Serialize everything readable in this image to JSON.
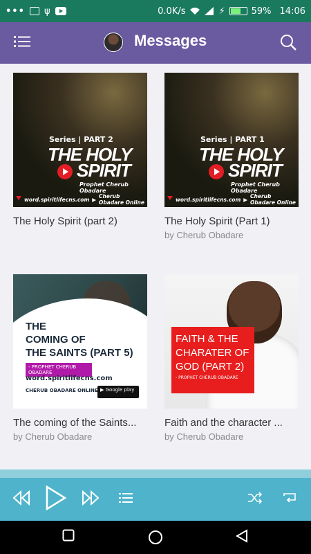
{
  "status": {
    "speed": "0.0K/s",
    "battery": "59%",
    "time": "14:06",
    "icons": [
      "more-icon",
      "cast-icon",
      "usb-icon",
      "youtube-icon",
      "wifi-icon",
      "signal-icon",
      "charging-icon",
      "battery-icon"
    ]
  },
  "appbar": {
    "title": "Messages",
    "menu_icon": "list-menu-icon",
    "search_icon": "search-icon",
    "color": "#6a5aa0"
  },
  "cards": [
    {
      "title": "The Holy Spirit (part 2)",
      "subtitle": "",
      "art": {
        "series": "Series | PART 2",
        "line1": "THE HOLY",
        "line2": "SPIRIT",
        "prophet": "Prophet Cherub Obadare",
        "url": "word.spiritlifecns.com",
        "channel": "Cherub Obadare Online"
      }
    },
    {
      "title": "The Holy Spirit (Part 1)",
      "subtitle": "by Cherub Obadare",
      "art": {
        "series": "Series | PART 1",
        "line1": "THE HOLY",
        "line2": "SPIRIT",
        "prophet": "Prophet Cherub Obadare",
        "url": "word.spiritlifecns.com",
        "channel": "Cherub Obadare Online"
      }
    },
    {
      "title": "The coming of the Saints...",
      "subtitle": "by Cherub Obadare",
      "art": {
        "line1": "THE",
        "line2": "COMING OF",
        "line3": "THE SAINTS (PART 5)",
        "tag": "- PROPHET CHERUB OBADARE",
        "url": "word.spiritlifecns.com",
        "channel": "CHERUB OBADARE ONLINE",
        "store": "Google play"
      }
    },
    {
      "title": "Faith and the character ...",
      "subtitle": "by Cherub Obadare",
      "art": {
        "line1": "FAITH & THE",
        "line2": "CHARATER OF",
        "line3": "GOD (PART 2)",
        "prophet": "- PROPHET CHERUB OBADARE"
      }
    }
  ],
  "player": {
    "color": "#4fb3cc",
    "buttons": [
      "rewind-icon",
      "play-icon",
      "fast-forward-icon",
      "queue-icon",
      "shuffle-icon",
      "repeat-icon"
    ]
  },
  "navbar": {
    "buttons": [
      "recent-apps-icon",
      "home-icon",
      "back-icon"
    ]
  }
}
